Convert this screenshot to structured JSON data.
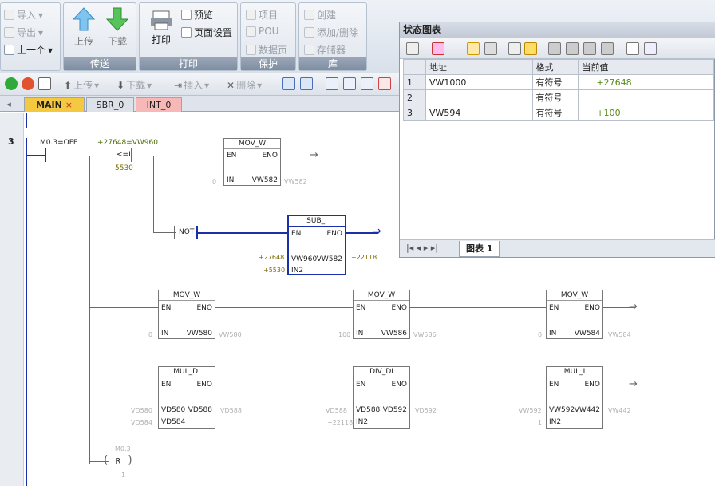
{
  "ribbon": {
    "transfer": {
      "caption": "传送",
      "import": "导入",
      "export": "导出",
      "previous": "上一个",
      "upload": "上传",
      "download": "下载"
    },
    "print": {
      "caption": "打印",
      "print": "打印",
      "preview": "预览",
      "page_setup": "页面设置"
    },
    "protect": {
      "caption": "保护",
      "project": "项目",
      "pou": "POU",
      "data_page": "数据页"
    },
    "library": {
      "caption": "库",
      "create": "创建",
      "add_remove": "添加/删除",
      "memory": "存储器"
    }
  },
  "toolbar": {
    "upload": "上传",
    "download": "下载",
    "insert": "插入",
    "delete": "删除"
  },
  "tabs": [
    {
      "label": "MAIN"
    },
    {
      "label": "SBR_0"
    },
    {
      "label": "INT_0"
    }
  ],
  "editor": {
    "network_no": "3",
    "contact1": "M0.3=OFF",
    "compare_top": "+27648=VW960",
    "compare_op": "<=I",
    "compare_bottom": "5530",
    "not_label": "NOT",
    "coil_top": "M0.3",
    "coil_label": "R",
    "coil_bottom": "1",
    "boxes": {
      "mov1": {
        "title": "MOV_W",
        "en": "EN",
        "eno": "ENO",
        "in_pin": "IN",
        "out_pin": "VW582",
        "in_val": "0",
        "out_val": "VW582"
      },
      "sub": {
        "title": "SUB_I",
        "en": "EN",
        "eno": "ENO",
        "in1_pin": "VW960",
        "out_pin": "VW582",
        "in2_pin": "IN2",
        "in1_val": "+27648",
        "in2_val": "+5530",
        "out_val": "+22118"
      },
      "mov2": {
        "title": "MOV_W",
        "en": "EN",
        "eno": "ENO",
        "in_pin": "IN",
        "out_pin": "VW580",
        "in_val": "0",
        "out_val": "VW580"
      },
      "mov3": {
        "title": "MOV_W",
        "en": "EN",
        "eno": "ENO",
        "in_pin": "IN",
        "out_pin": "VW586",
        "in_val": "100",
        "out_val": "VW586"
      },
      "mov4": {
        "title": "MOV_W",
        "en": "EN",
        "eno": "ENO",
        "in_pin": "IN",
        "out_pin": "VW584",
        "in_val": "0",
        "out_val": "VW584"
      },
      "mul_di": {
        "title": "MUL_DI",
        "en": "EN",
        "eno": "ENO",
        "in1_pin": "VD580",
        "in2_pin": "VD584",
        "out_pin": "VD588",
        "in1_val": "VD580",
        "in2_val": "VD584",
        "out_val": "VD588"
      },
      "div_di": {
        "title": "DIV_DI",
        "en": "EN",
        "eno": "ENO",
        "in1_pin": "VD588",
        "in2_pin": "IN2",
        "out_pin": "VD592",
        "in1_val": "VD588",
        "in2_val": "+22118",
        "out_val": "VD592"
      },
      "mul_i": {
        "title": "MUL_I",
        "en": "EN",
        "eno": "ENO",
        "in1_pin": "VW592",
        "in2_pin": "IN2",
        "out_pin": "VW442",
        "in1_val": "VW592",
        "in2_val": "1",
        "out_val": "VW442"
      }
    }
  },
  "status_chart": {
    "title": "状态图表",
    "headers": [
      "地址",
      "格式",
      "当前值"
    ],
    "rows": [
      {
        "no": "1",
        "address": "VW1000",
        "format": "有符号",
        "value": "+27648"
      },
      {
        "no": "2",
        "address": "",
        "format": "有符号",
        "value": ""
      },
      {
        "no": "3",
        "address": "VW594",
        "format": "有符号",
        "value": "+100"
      }
    ],
    "tab_label": "图表  1"
  },
  "colors": {
    "accent_blue": "#1b2fa8",
    "value_green": "#5b8a1e",
    "tab_active": "#f5c842",
    "tab_int": "#f7b8b8"
  }
}
